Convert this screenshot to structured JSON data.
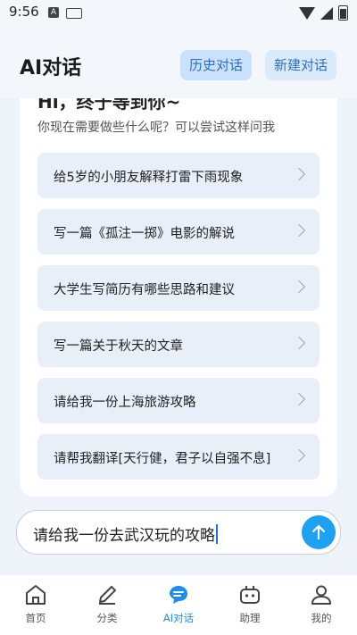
{
  "status": {
    "time": "9:56"
  },
  "header": {
    "title": "AI对话",
    "history_btn": "历史对话",
    "new_btn": "新建对话"
  },
  "card": {
    "greeting": "Hi，终于等到你~",
    "subtitle": "你现在需要做些什么呢？可以尝试这样问我",
    "suggestions": [
      "给5岁的小朋友解释打雷下雨现象",
      "写一篇《孤注一掷》电影的解说",
      "大学生写简历有哪些思路和建议",
      "写一篇关于秋天的文章",
      "请给我一份上海旅游攻略",
      "请帮我翻译[天行健，君子以自强不息]"
    ]
  },
  "input": {
    "value": "请给我一份去武汉玩的攻略"
  },
  "tabs": [
    {
      "label": "首页",
      "icon": "home-icon"
    },
    {
      "label": "分类",
      "icon": "pencil-icon"
    },
    {
      "label": "AI对话",
      "icon": "chat-icon",
      "active": true
    },
    {
      "label": "助理",
      "icon": "robot-icon"
    },
    {
      "label": "我的",
      "icon": "user-icon"
    }
  ],
  "colors": {
    "accent": "#1e8ee8",
    "send": "#1da1f2",
    "background": "#eef2f9"
  }
}
